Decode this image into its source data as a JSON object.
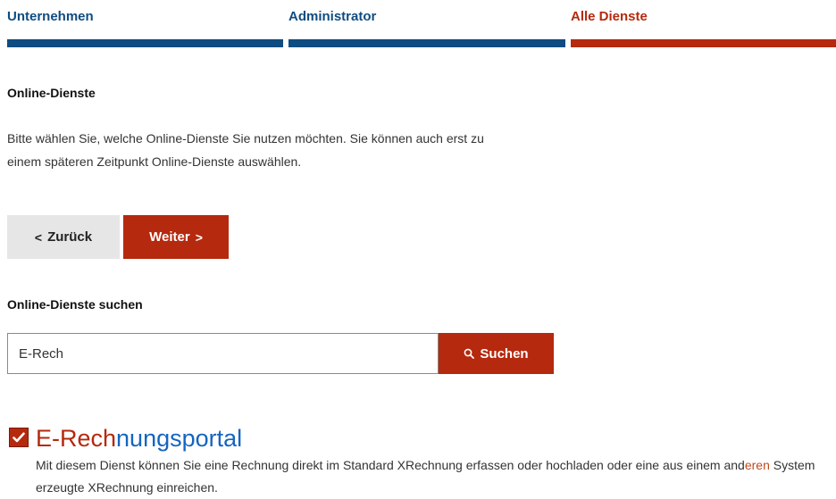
{
  "steps": [
    {
      "label": "Unternehmen",
      "state": "done"
    },
    {
      "label": "Administrator",
      "state": "done"
    },
    {
      "label": "Alle Dienste",
      "state": "active"
    }
  ],
  "section": {
    "title": "Online-Dienste",
    "intro": "Bitte wählen Sie, welche Online-Dienste Sie nutzen möchten. Sie können auch erst zu einem späteren Zeitpunkt Online-Dienste auswählen."
  },
  "nav": {
    "back_label": "Zurück",
    "next_label": "Weiter"
  },
  "search": {
    "heading": "Online-Dienste suchen",
    "value": "E-Rech",
    "button_label": "Suchen"
  },
  "result": {
    "checked": true,
    "title_match": "E-Rech",
    "title_rest": "nungsportal",
    "desc_part1": "Mit diesem Dienst können Sie eine Rechnung direkt im Standard XRechnung erfassen oder hochladen oder eine aus einem and",
    "desc_match": "eren",
    "desc_part2": " System erzeugte XRechnung einreichen."
  },
  "colors": {
    "primary_blue": "#0f4c81",
    "accent_red": "#b5290e"
  }
}
